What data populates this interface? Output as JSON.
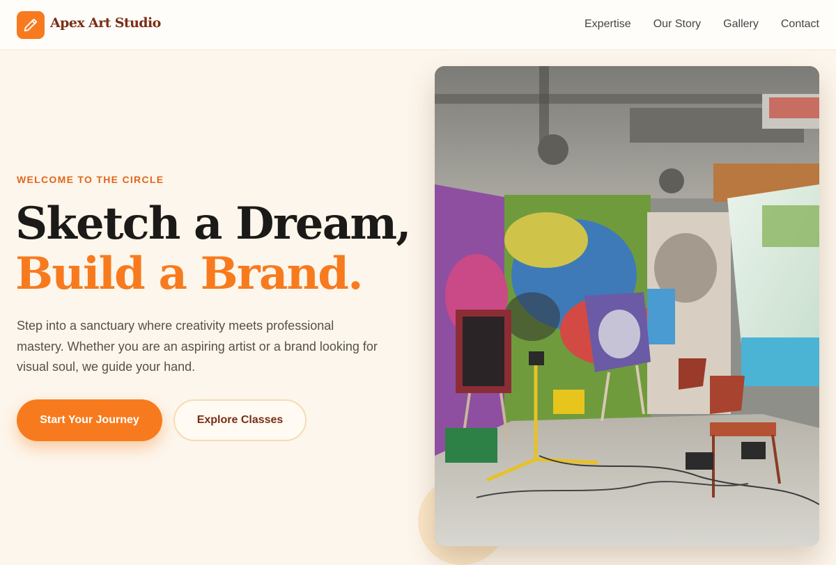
{
  "header": {
    "brand": "Apex Art Studio",
    "logo_icon": "pencil-icon",
    "nav": [
      {
        "label": "Expertise"
      },
      {
        "label": "Our Story"
      },
      {
        "label": "Gallery"
      },
      {
        "label": "Contact"
      }
    ]
  },
  "hero": {
    "eyebrow": "WELCOME TO THE CIRCLE",
    "headline_line1": "Sketch a Dream,",
    "headline_line2": "Build a Brand.",
    "description": "Step into a sanctuary where creativity meets professional mastery. Whether you are an aspiring artist or a brand looking for visual soul, we guide your hand.",
    "primary_button": "Start Your Journey",
    "secondary_button": "Explore Classes"
  },
  "colors": {
    "accent": "#f77b1e",
    "brand_text": "#7a2e15",
    "background": "#fdf6ec"
  }
}
